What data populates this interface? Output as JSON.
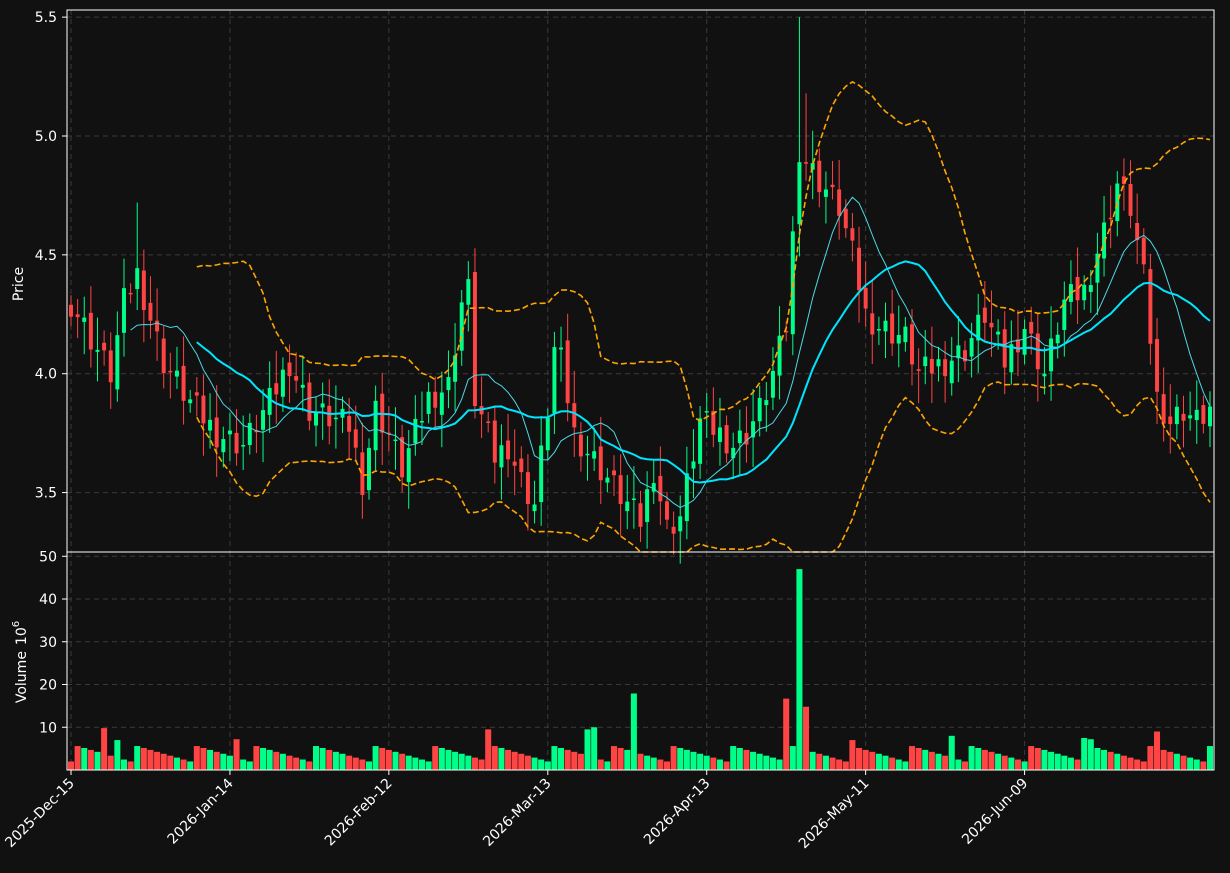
{
  "chart_data": {
    "type": "candlestick",
    "x_tick_labels": [
      "2025-Dec-15",
      "2026-Jan-14",
      "2026-Feb-12",
      "2026-Mar-13",
      "2026-Apr-13",
      "2026-May-11",
      "2026-Jun-09"
    ],
    "x_tick_indices": [
      0,
      24,
      48,
      72,
      96,
      120,
      144
    ],
    "price_panel": {
      "ylabel": "Price",
      "ylim": [
        3.25,
        5.53
      ],
      "yticks": [
        3.5,
        4.0,
        4.5,
        5.0,
        5.5
      ],
      "ytick_labels": [
        "3.5",
        "4.0",
        "4.5",
        "5.0",
        "5.5"
      ],
      "grid": true
    },
    "volume_panel": {
      "ylabel": "Volume",
      "ylabel_exponent": "10",
      "ylabel_exponent_power": "6",
      "ylim": [
        0,
        51
      ],
      "yticks": [
        10,
        20,
        30,
        40,
        50
      ],
      "ytick_labels": [
        "10",
        "20",
        "30",
        "40",
        "50"
      ],
      "grid": true
    },
    "colors": {
      "up": "#00ff88",
      "down": "#ff4444",
      "ma_fast": "#00e5ff",
      "ma_slow": "#4dd9e6",
      "bollinger": "#ffa500",
      "background": "#111111",
      "grid": "#3a3a3a",
      "text": "#ffffff"
    },
    "anchors": [
      [
        0,
        4.3
      ],
      [
        6,
        4.0
      ],
      [
        8,
        4.3
      ],
      [
        10,
        4.42
      ],
      [
        14,
        4.05
      ],
      [
        18,
        3.88
      ],
      [
        22,
        3.75
      ],
      [
        26,
        3.7
      ],
      [
        30,
        3.88
      ],
      [
        33,
        4.05
      ],
      [
        36,
        3.85
      ],
      [
        42,
        3.78
      ],
      [
        44,
        3.55
      ],
      [
        46,
        3.85
      ],
      [
        48,
        3.75
      ],
      [
        50,
        3.6
      ],
      [
        54,
        3.9
      ],
      [
        57,
        3.95
      ],
      [
        59,
        4.3
      ],
      [
        60,
        4.35
      ],
      [
        61,
        3.9
      ],
      [
        64,
        3.65
      ],
      [
        66,
        3.7
      ],
      [
        68,
        3.55
      ],
      [
        70,
        3.45
      ],
      [
        72,
        3.85
      ],
      [
        73,
        4.1
      ],
      [
        74,
        4.05
      ],
      [
        76,
        3.75
      ],
      [
        80,
        3.6
      ],
      [
        84,
        3.45
      ],
      [
        86,
        3.38
      ],
      [
        88,
        3.6
      ],
      [
        90,
        3.35
      ],
      [
        92,
        3.4
      ],
      [
        95,
        3.8
      ],
      [
        98,
        3.75
      ],
      [
        100,
        3.7
      ],
      [
        102,
        3.75
      ],
      [
        104,
        3.85
      ],
      [
        106,
        4.0
      ],
      [
        108,
        4.2
      ],
      [
        110,
        4.95
      ],
      [
        112,
        4.85
      ],
      [
        116,
        4.7
      ],
      [
        118,
        4.5
      ],
      [
        120,
        4.25
      ],
      [
        122,
        4.2
      ],
      [
        126,
        4.15
      ],
      [
        128,
        4.0
      ],
      [
        132,
        4.05
      ],
      [
        135,
        4.1
      ],
      [
        138,
        4.25
      ],
      [
        141,
        4.05
      ],
      [
        144,
        4.2
      ],
      [
        147,
        4.0
      ],
      [
        150,
        4.3
      ],
      [
        153,
        4.35
      ],
      [
        156,
        4.6
      ],
      [
        158,
        4.8
      ],
      [
        160,
        4.7
      ],
      [
        162,
        4.4
      ],
      [
        164,
        3.9
      ],
      [
        166,
        3.8
      ],
      [
        168,
        3.85
      ],
      [
        170,
        3.8
      ],
      [
        172,
        3.85
      ]
    ],
    "volume_spikes": {
      "5": 9.8,
      "7": 7.0,
      "25": 7.2,
      "63": 9.5,
      "78": 9.5,
      "79": 10.0,
      "85": 17.9,
      "108": 16.7,
      "110": 47.0,
      "111": 14.8,
      "118": 7.0,
      "133": 8.0,
      "153": 7.5,
      "154": 7.2,
      "164": 9.0
    },
    "ma_fast_window": 20,
    "ma_slow_window": 10,
    "bollinger_k": 2
  }
}
